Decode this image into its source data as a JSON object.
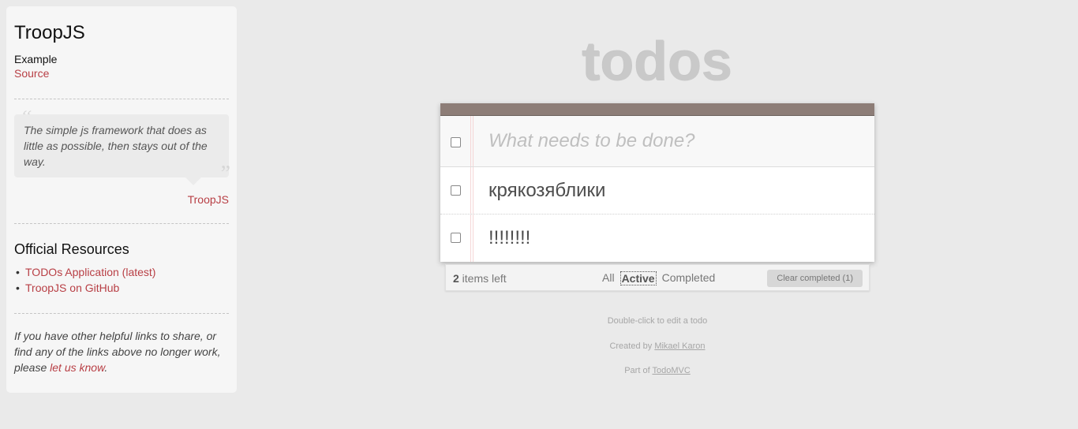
{
  "sidebar": {
    "title": "TroopJS",
    "example_label": "Example",
    "source_link": "Source",
    "quote": {
      "text": "The simple js framework that does as little as possible, then stays out of the way.",
      "author": "TroopJS"
    },
    "resources_heading": "Official Resources",
    "resources": [
      {
        "label": "TODOs Application (latest)"
      },
      {
        "label": "TroopJS on GitHub"
      }
    ],
    "footnote": {
      "prefix": "If you have other helpful links to share, or find any of the links above no longer work, please ",
      "link": "let us know",
      "suffix": "."
    }
  },
  "app": {
    "title": "todos",
    "new_todo_placeholder": "What needs to be done?",
    "todos": [
      {
        "text": "крякозяблики",
        "completed": false
      },
      {
        "text": "!!!!!!!!",
        "completed": false
      }
    ],
    "footer": {
      "count": "2",
      "count_suffix": " items left",
      "filters": [
        "All",
        "Active",
        "Completed"
      ],
      "selected_filter": "Active",
      "clear_label": "Clear completed (1)"
    }
  },
  "info": {
    "hint": "Double-click to edit a todo",
    "created_prefix": "Created by ",
    "created_by": "Mikael Karon",
    "part_prefix": "Part of ",
    "part_of": "TodoMVC"
  },
  "colors": {
    "accent": "#b83f45",
    "header_bar": "#8d7d77",
    "background": "#eaeaea"
  }
}
